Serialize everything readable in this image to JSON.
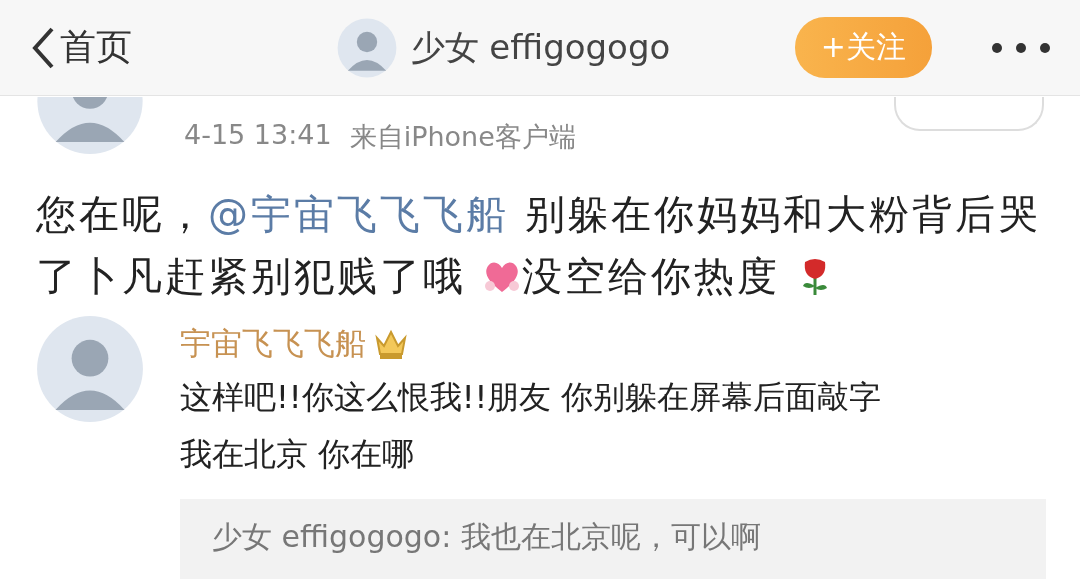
{
  "header": {
    "back_label": "首页",
    "user_name": "少女 effigogogo",
    "follow_button": "+关注"
  },
  "post": {
    "time": "4-15 13:41",
    "source": "来自iPhone客户端",
    "body": [
      {
        "kind": "text",
        "text": "您在呢，"
      },
      {
        "kind": "mention",
        "text": "@宇宙飞飞飞船"
      },
      {
        "kind": "text",
        "text": " 别躲在你妈妈和大粉背后哭了卜凡赶紧别犯贱了哦 "
      },
      {
        "kind": "heart"
      },
      {
        "kind": "text",
        "text": "没空给你热度 "
      },
      {
        "kind": "rose"
      }
    ]
  },
  "comment": {
    "user_name": "宇宙飞飞飞船",
    "text_lines": [
      "这样吧!!你这么恨我!!朋友 你别躲在屏幕后面敲字",
      "我在北京 你在哪"
    ],
    "reply": "少女 effigogogo: 我也在北京呢，可以啊"
  }
}
